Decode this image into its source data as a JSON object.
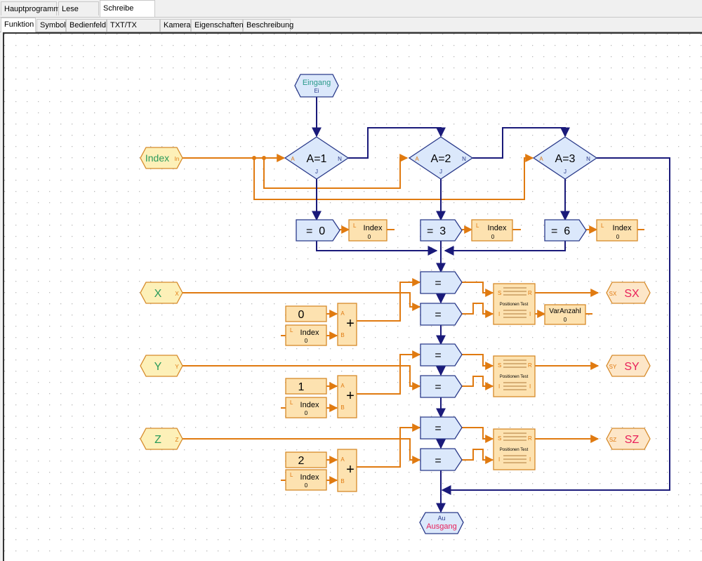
{
  "tabs": [
    "Hauptprogramm",
    "Lese Array",
    "Schreibe Array"
  ],
  "active_tab": "Schreibe Array",
  "subtabs": [
    "Funktion",
    "Symbol",
    "Bedienfeld",
    "TXT/TX Display",
    "Kamera",
    "Eigenschaften",
    "Beschreibung"
  ],
  "active_subtab": "Funktion",
  "diagram": {
    "entry": {
      "label": "Eingang",
      "port": "Ei"
    },
    "exit": {
      "label": "Ausgang",
      "port": "Au"
    },
    "index_input": {
      "label": "Index",
      "port": "In"
    },
    "branches": [
      {
        "cond": "A=1",
        "port_a": "A",
        "port_n": "N",
        "port_j": "J",
        "assign": "=  0",
        "var_port": "L",
        "var": "Index",
        "var_value": "0"
      },
      {
        "cond": "A=2",
        "port_a": "A",
        "port_n": "N",
        "port_j": "J",
        "assign": "=  3",
        "var_port": "L",
        "var": "Index",
        "var_value": "0"
      },
      {
        "cond": "A=3",
        "port_a": "A",
        "port_n": "N",
        "port_j": "J",
        "assign": "=  6",
        "var_port": "L",
        "var": "Index",
        "var_value": "0"
      }
    ],
    "assign_op": "=",
    "plus_op": "+",
    "plus_port_a": "A",
    "plus_port_b": "B",
    "rows": [
      {
        "input": "X",
        "input_port": "X",
        "constant": "0",
        "idx_port": "L",
        "idx_label": "Index",
        "idx_value": "0",
        "ff_title": "Positionen Test",
        "ff_s": "S",
        "ff_r": "R",
        "ff_i_left": "I",
        "ff_i_right": "I",
        "output": "SX",
        "output_port": "SX"
      },
      {
        "input": "Y",
        "input_port": "Y",
        "constant": "1",
        "idx_port": "L",
        "idx_label": "Index",
        "idx_value": "0",
        "ff_title": "Positionen Test",
        "ff_s": "S",
        "ff_r": "R",
        "ff_i_left": "I",
        "ff_i_right": "I",
        "output": "SY",
        "output_port": "SY"
      },
      {
        "input": "Z",
        "input_port": "Z",
        "constant": "2",
        "idx_port": "L",
        "idx_label": "Index",
        "idx_value": "0",
        "ff_title": "Positionen Test",
        "ff_s": "S",
        "ff_r": "R",
        "ff_i_left": "I",
        "ff_i_right": "I",
        "output": "SZ",
        "output_port": "SZ"
      }
    ],
    "counter": {
      "label": "VarAnzahl",
      "value": "0"
    }
  },
  "colors": {
    "flow_line": "#1a1a7a",
    "data_line": "#e07a10",
    "block_blue_fill": "#dbe8fb",
    "block_blue_border": "#2a3a8a",
    "block_orange_fill": "#fde2b0",
    "block_orange_border": "#d68a2a",
    "input_hex_fill": "#fdf0b8",
    "output_hex_fill": "#fde6c8",
    "input_text": "#2a9a5a",
    "output_text": "#e8205a",
    "port_text": "#2a8a9a"
  }
}
